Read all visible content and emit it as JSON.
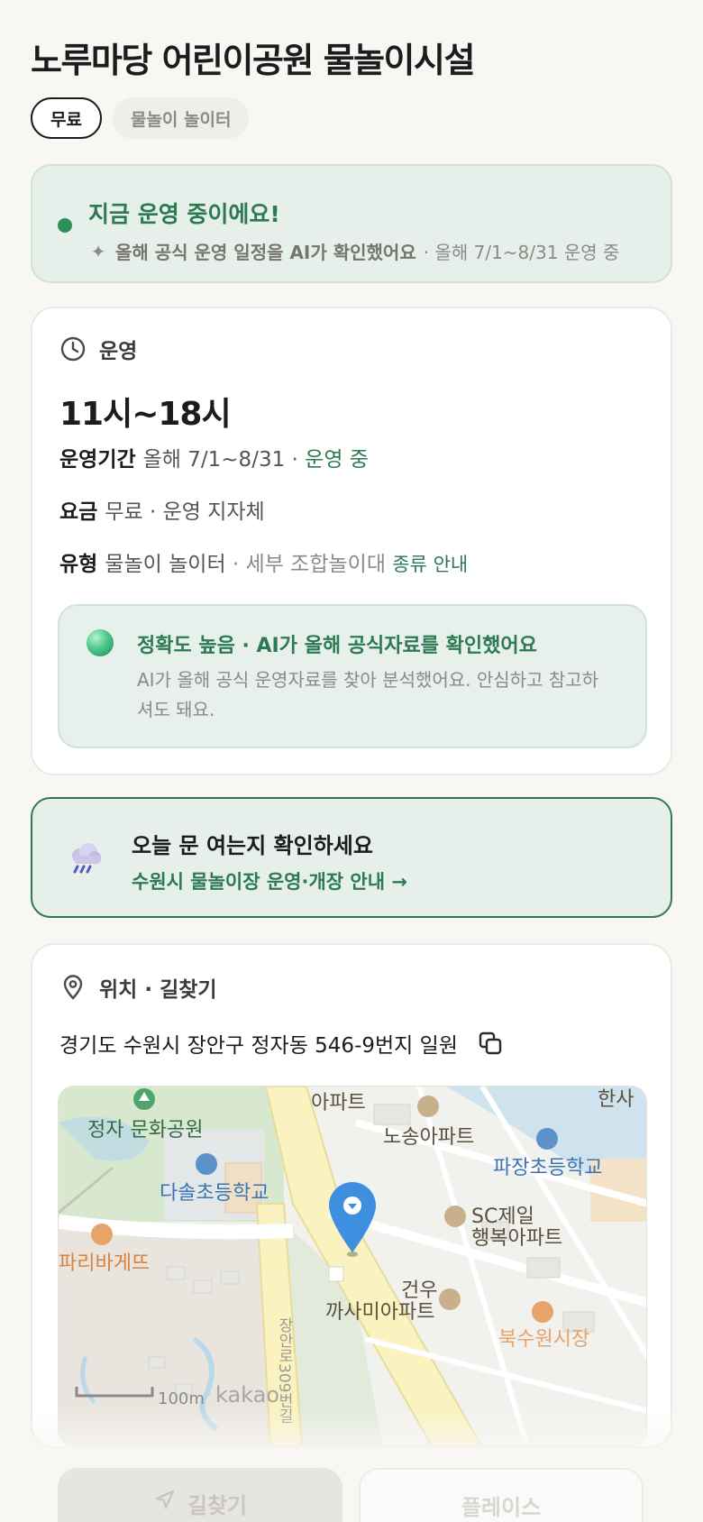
{
  "page": {
    "title": "노루마당 어린이공원 물놀이시설",
    "chips": [
      "무료",
      "물놀이 놀이터"
    ]
  },
  "status": {
    "title": "지금 운영 중이에요!",
    "sub_bold": "올해 공식 운영 일정을 AI가 확인했어요",
    "sub_rest": "· 올해 7/1~8/31 운영 중"
  },
  "hours": {
    "section_title": "운영",
    "time": "11시~18시",
    "period_key": "운영기간",
    "period_value": "올해 7/1~8/31",
    "period_status": "· 운영 중",
    "fee_key": "요금",
    "fee_value": "무료 · 운영 지자체",
    "type_key": "유형",
    "type_value": "물놀이 놀이터",
    "type_detail": "· 세부 조합놀이대",
    "type_link": "종류 안내"
  },
  "accuracy": {
    "title": "정확도 높음 · AI가 올해 공식자료를 확인했어요",
    "body": "AI가 올해 공식 운영자료를 찾아 분석했어요. 안심하고 참고하셔도 돼요."
  },
  "notice": {
    "title": "오늘 문 여는지 확인하세요",
    "link": "수원시 물놀이장 운영·개장 안내 →"
  },
  "location": {
    "section_title": "위치 · 길찾기",
    "address": "경기도 수원시 장안구 정자동 546-9번지 일원",
    "map_labels": {
      "park": "정자 문화공원",
      "apt1": "아파트",
      "apt2": "노송아파트",
      "school1": "다솔초등학교",
      "school2": "파장초등학교",
      "cut_top": "한사",
      "bakery": "파리바게뜨",
      "sc1": "SC제일",
      "sc2": "행복아파트",
      "apt3a": "건우",
      "apt3b": "까사미아파트",
      "market": "북수원시장",
      "road": "장안로309번길",
      "scale": "100m",
      "brand": "kakao"
    }
  },
  "actions": {
    "route": "길찾기",
    "place": "플레이스"
  },
  "colors": {
    "accent_green": "#2b7a52",
    "status_bg": "#e6efea",
    "page_bg": "#f8f7f4"
  }
}
